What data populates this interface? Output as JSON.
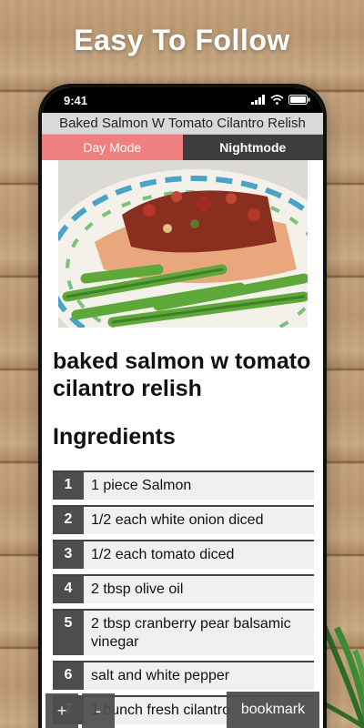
{
  "headline": "Easy To Follow",
  "status": {
    "time": "9:41"
  },
  "app": {
    "title": "Baked Salmon W Tomato Cilantro Relish",
    "modes": {
      "day": "Day Mode",
      "night": "Nightmode"
    }
  },
  "recipe": {
    "name": "baked salmon w tomato cilantro relish",
    "ingredients_heading": "Ingredients",
    "ingredients": [
      {
        "num": "1",
        "text": "1 piece Salmon"
      },
      {
        "num": "2",
        "text": "1/2 each white onion diced"
      },
      {
        "num": "3",
        "text": "1/2 each tomato diced"
      },
      {
        "num": "4",
        "text": "2 tbsp olive oil"
      },
      {
        "num": "5",
        "text": "2 tbsp cranberry pear balsamic vinegar"
      },
      {
        "num": "6",
        "text": "salt and white pepper"
      },
      {
        "num": "7",
        "text": "1 bunch fresh cilantro"
      }
    ]
  },
  "controls": {
    "zoom_in": "+",
    "zoom_out": "-",
    "bookmark": "bookmark"
  },
  "icons": [
    "signal-icon",
    "wifi-icon",
    "battery-icon"
  ]
}
